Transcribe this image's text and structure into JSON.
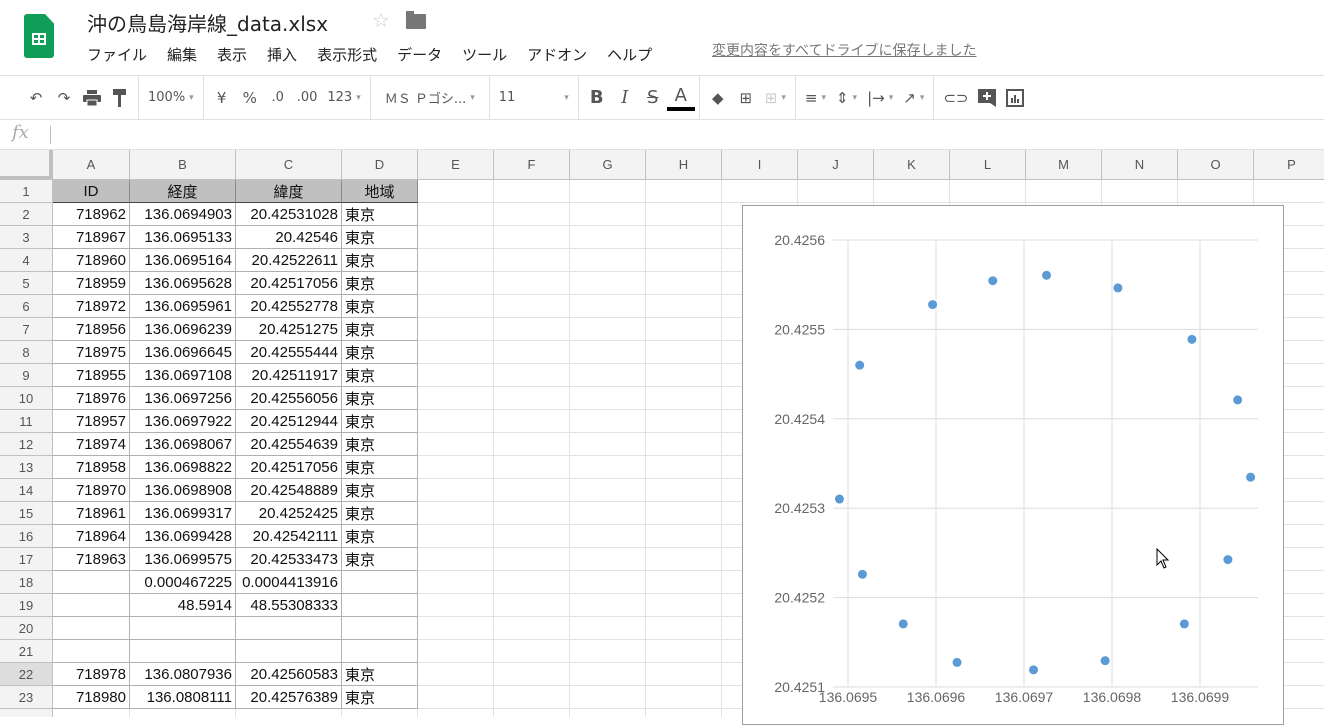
{
  "app": {
    "title": "沖の鳥島海岸線_data.xlsx",
    "star_icon": "☆",
    "menu": [
      "ファイル",
      "編集",
      "表示",
      "挿入",
      "表示形式",
      "データ",
      "ツール",
      "アドオン",
      "ヘルプ"
    ],
    "save_status": "変更内容をすべてドライブに保存しました"
  },
  "toolbar": {
    "zoom": "100%",
    "currency": "¥",
    "percent": "%",
    "decrease_decimal": ".0",
    "increase_decimal": ".00",
    "more_formats": "123",
    "font": "ＭＳ Ｐゴシ...",
    "font_size": "11",
    "bold": "B",
    "italic": "I",
    "strike": "S",
    "text_color": "A"
  },
  "formula_bar": {
    "label": "fx",
    "value": ""
  },
  "columns": [
    "A",
    "B",
    "C",
    "D",
    "E",
    "F",
    "G",
    "H",
    "I",
    "J",
    "K",
    "L",
    "M",
    "N",
    "O",
    "P"
  ],
  "rows": [
    {
      "n": "1",
      "cells": [
        "ID",
        "経度",
        "緯度",
        "地域"
      ],
      "header": true
    },
    {
      "n": "2",
      "cells": [
        "718962",
        "136.0694903",
        "20.42531028",
        "東京"
      ]
    },
    {
      "n": "3",
      "cells": [
        "718967",
        "136.0695133",
        "20.42546",
        "東京"
      ]
    },
    {
      "n": "4",
      "cells": [
        "718960",
        "136.0695164",
        "20.42522611",
        "東京"
      ]
    },
    {
      "n": "5",
      "cells": [
        "718959",
        "136.0695628",
        "20.42517056",
        "東京"
      ]
    },
    {
      "n": "6",
      "cells": [
        "718972",
        "136.0695961",
        "20.42552778",
        "東京"
      ]
    },
    {
      "n": "7",
      "cells": [
        "718956",
        "136.0696239",
        "20.4251275",
        "東京"
      ]
    },
    {
      "n": "8",
      "cells": [
        "718975",
        "136.0696645",
        "20.42555444",
        "東京"
      ]
    },
    {
      "n": "9",
      "cells": [
        "718955",
        "136.0697108",
        "20.42511917",
        "東京"
      ]
    },
    {
      "n": "10",
      "cells": [
        "718976",
        "136.0697256",
        "20.42556056",
        "東京"
      ]
    },
    {
      "n": "11",
      "cells": [
        "718957",
        "136.0697922",
        "20.42512944",
        "東京"
      ]
    },
    {
      "n": "12",
      "cells": [
        "718974",
        "136.0698067",
        "20.42554639",
        "東京"
      ]
    },
    {
      "n": "13",
      "cells": [
        "718958",
        "136.0698822",
        "20.42517056",
        "東京"
      ]
    },
    {
      "n": "14",
      "cells": [
        "718970",
        "136.0698908",
        "20.42548889",
        "東京"
      ]
    },
    {
      "n": "15",
      "cells": [
        "718961",
        "136.0699317",
        "20.4252425",
        "東京"
      ]
    },
    {
      "n": "16",
      "cells": [
        "718964",
        "136.0699428",
        "20.42542111",
        "東京"
      ]
    },
    {
      "n": "17",
      "cells": [
        "718963",
        "136.0699575",
        "20.42533473",
        "東京"
      ]
    },
    {
      "n": "18",
      "cells": [
        "",
        "0.000467225",
        "0.0004413916",
        ""
      ]
    },
    {
      "n": "19",
      "cells": [
        "",
        "48.5914",
        "48.55308333",
        ""
      ]
    },
    {
      "n": "20",
      "cells": [
        "",
        "",
        "",
        ""
      ]
    },
    {
      "n": "21",
      "cells": [
        "",
        "",
        "",
        ""
      ]
    },
    {
      "n": "22",
      "cells": [
        "718978",
        "136.0807936",
        "20.42560583",
        "東京"
      ]
    },
    {
      "n": "23",
      "cells": [
        "718980",
        "136.0808111",
        "20.42576389",
        "東京"
      ]
    }
  ],
  "chart_data": {
    "type": "scatter",
    "title": "",
    "xlabel": "",
    "ylabel": "",
    "xlim": [
      136.069483,
      136.069965
    ],
    "ylim": [
      20.4251,
      20.4256
    ],
    "xticks": [
      "136.0695",
      "136.0696",
      "136.0697",
      "136.0698",
      "136.0699"
    ],
    "yticks": [
      "20.4251",
      "20.4252",
      "20.4253",
      "20.4254",
      "20.4255",
      "20.4256"
    ],
    "grid": true,
    "color": "#5b9bd5",
    "x": [
      136.0694903,
      136.0695133,
      136.0695164,
      136.0695628,
      136.0695961,
      136.0696239,
      136.0696645,
      136.0697108,
      136.0697256,
      136.0697922,
      136.0698067,
      136.0698822,
      136.0698908,
      136.0699317,
      136.0699428,
      136.0699575
    ],
    "y": [
      20.42531028,
      20.42546,
      20.42522611,
      20.42517056,
      20.42552778,
      20.4251275,
      20.42555444,
      20.42511917,
      20.42556056,
      20.42512944,
      20.42554639,
      20.42517056,
      20.42548889,
      20.4252425,
      20.42542111,
      20.42533473
    ]
  }
}
